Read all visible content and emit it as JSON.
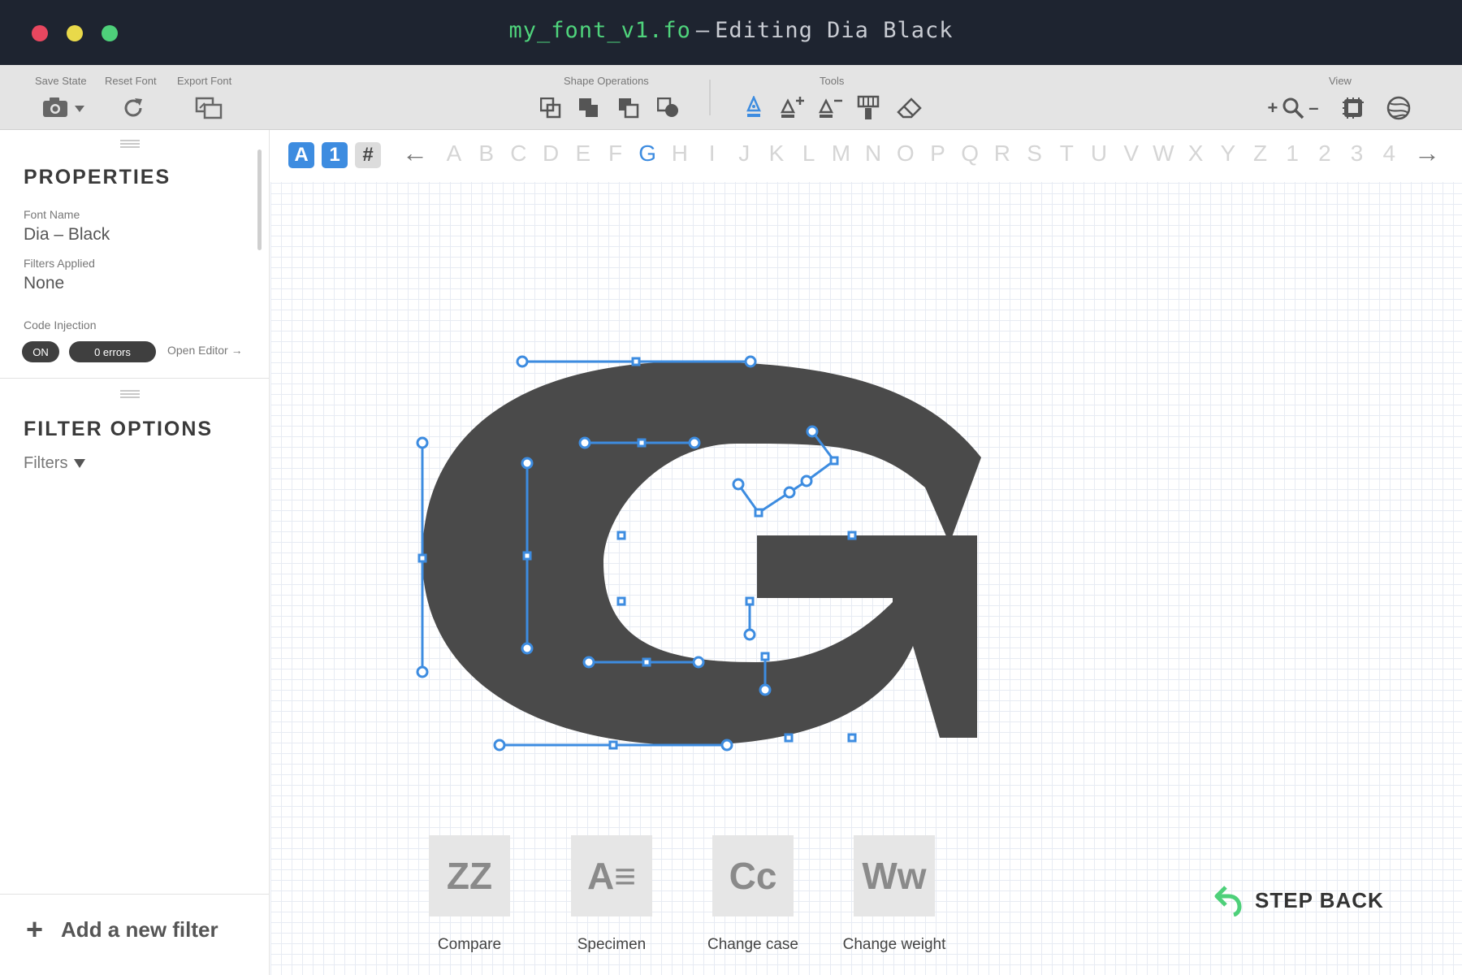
{
  "window": {
    "file_name": "my_font_v1.fo",
    "separator": "–",
    "subtitle": "Editing Dia Black"
  },
  "toolbar": {
    "save_state_label": "Save State",
    "reset_font_label": "Reset Font",
    "export_font_label": "Export Font",
    "shape_operations_label": "Shape Operations",
    "tools_label": "Tools",
    "view_label": "View",
    "icons": [
      "camera-icon",
      "refresh-icon",
      "export-icon",
      "union-icon",
      "subtract-icon",
      "intersect-icon",
      "exclude-icon",
      "pen-tool-icon",
      "add-point-icon",
      "remove-point-icon",
      "paint-brush-icon",
      "eraser-icon",
      "zoom-icon",
      "grid-view-icon",
      "globe-icon"
    ],
    "zoom_plus": "+",
    "zoom_minus": "–",
    "accent_color": "#3d8ce0"
  },
  "properties": {
    "heading": "PROPERTIES",
    "font_name_label": "Font Name",
    "font_name_value": "Dia – Black",
    "filters_applied_label": "Filters Applied",
    "filters_applied_value": "None",
    "code_injection_label": "Code Injection",
    "code_injection_state": "ON",
    "errors_text": "0 errors",
    "open_editor_text": "Open Editor →"
  },
  "filter_options": {
    "heading": "FILTER OPTIONS",
    "filters_dropdown": "Filters",
    "add_filter_text": "Add a new filter"
  },
  "glyph_bar": {
    "tabs": [
      "A",
      "1",
      "#"
    ],
    "active_tab_index": 1,
    "prev_arrow": "←",
    "next_arrow": "→",
    "letters": [
      "A",
      "B",
      "C",
      "D",
      "E",
      "F",
      "G",
      "H",
      "I",
      "J",
      "K",
      "L",
      "M",
      "N",
      "O",
      "P",
      "Q",
      "R",
      "S",
      "T",
      "U",
      "V",
      "W",
      "X",
      "Y",
      "Z",
      "1",
      "2",
      "3",
      "4"
    ],
    "selected_letter": "G"
  },
  "actions": [
    {
      "icon_text": "ZZ",
      "label": "Compare"
    },
    {
      "icon_text": "A≡",
      "label": "Specimen"
    },
    {
      "icon_text": "Cc",
      "label": "Change case"
    },
    {
      "icon_text": "Ww",
      "label": "Change weight"
    }
  ],
  "step_back": {
    "label": "STEP BACK",
    "icon_color": "#4ed07a"
  },
  "glyph": {
    "fill_color": "#4a4a4a",
    "handle_color": "#3d8ce0"
  }
}
